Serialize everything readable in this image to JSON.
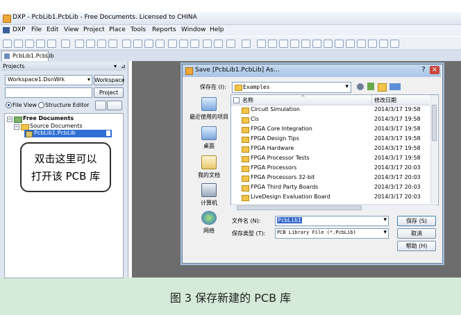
{
  "window": {
    "title": "DXP - PcbLib1.PcbLib - Free Documents. Licensed to CHINA"
  },
  "menu": [
    "DXP",
    "File",
    "Edit",
    "View",
    "Project",
    "Place",
    "Tools",
    "Reports",
    "Window",
    "Help"
  ],
  "document_tab": "PcbLib1.PcbLib",
  "projects_panel": {
    "header": "Projects",
    "workspace_select": "Workspace1.DsnWrk",
    "workspace_button": "Workspace",
    "project_button": "Project",
    "view_file": "File View",
    "view_structure": "Structure Editor",
    "tree": {
      "root": "Free Documents",
      "folder": "Source Documents",
      "file": "PcbLib1.PcbLib"
    }
  },
  "callout": {
    "line1": "双击这里可以",
    "line2": "打开该 PCB 库"
  },
  "dialog": {
    "title": "Save [PcbLib1.PcbLib] As...",
    "save_in_label": "保存在 (I):",
    "save_in_value": "Examples",
    "column_name": "名称",
    "column_date": "修改日期",
    "places": [
      "最近使用的项目",
      "桌面",
      "我的文档",
      "计算机",
      "网络"
    ],
    "files": [
      {
        "name": "Circuit Simulation",
        "date": "2014/3/17 19:58"
      },
      {
        "name": "Cis",
        "date": "2014/3/17 19:58"
      },
      {
        "name": "FPGA Core Integration",
        "date": "2014/3/17 19:58"
      },
      {
        "name": "FPGA Design Tips",
        "date": "2014/3/17 19:58"
      },
      {
        "name": "FPGA Hardware",
        "date": "2014/3/17 19:58"
      },
      {
        "name": "FPGA Processor Tests",
        "date": "2014/3/17 19:58"
      },
      {
        "name": "FPGA Processors",
        "date": "2014/3/17 20:03"
      },
      {
        "name": "FPGA Processors 32-bit",
        "date": "2014/3/17 20:03"
      },
      {
        "name": "FPGA Third Party Boards",
        "date": "2014/3/17 20:03"
      },
      {
        "name": "LiveDesign Evaluation Board",
        "date": "2014/3/17 20:03"
      }
    ],
    "filename_label": "文件名 (N):",
    "filename_value": "PcbLib1",
    "filetype_label": "保存类型 (T):",
    "filetype_value": "PCB Library File (*.PcbLib)",
    "save_button": "保存 (S)",
    "cancel_button": "取消",
    "help_button": "帮助 (H)"
  },
  "caption": "图 3  保存新建的 PCB 库"
}
